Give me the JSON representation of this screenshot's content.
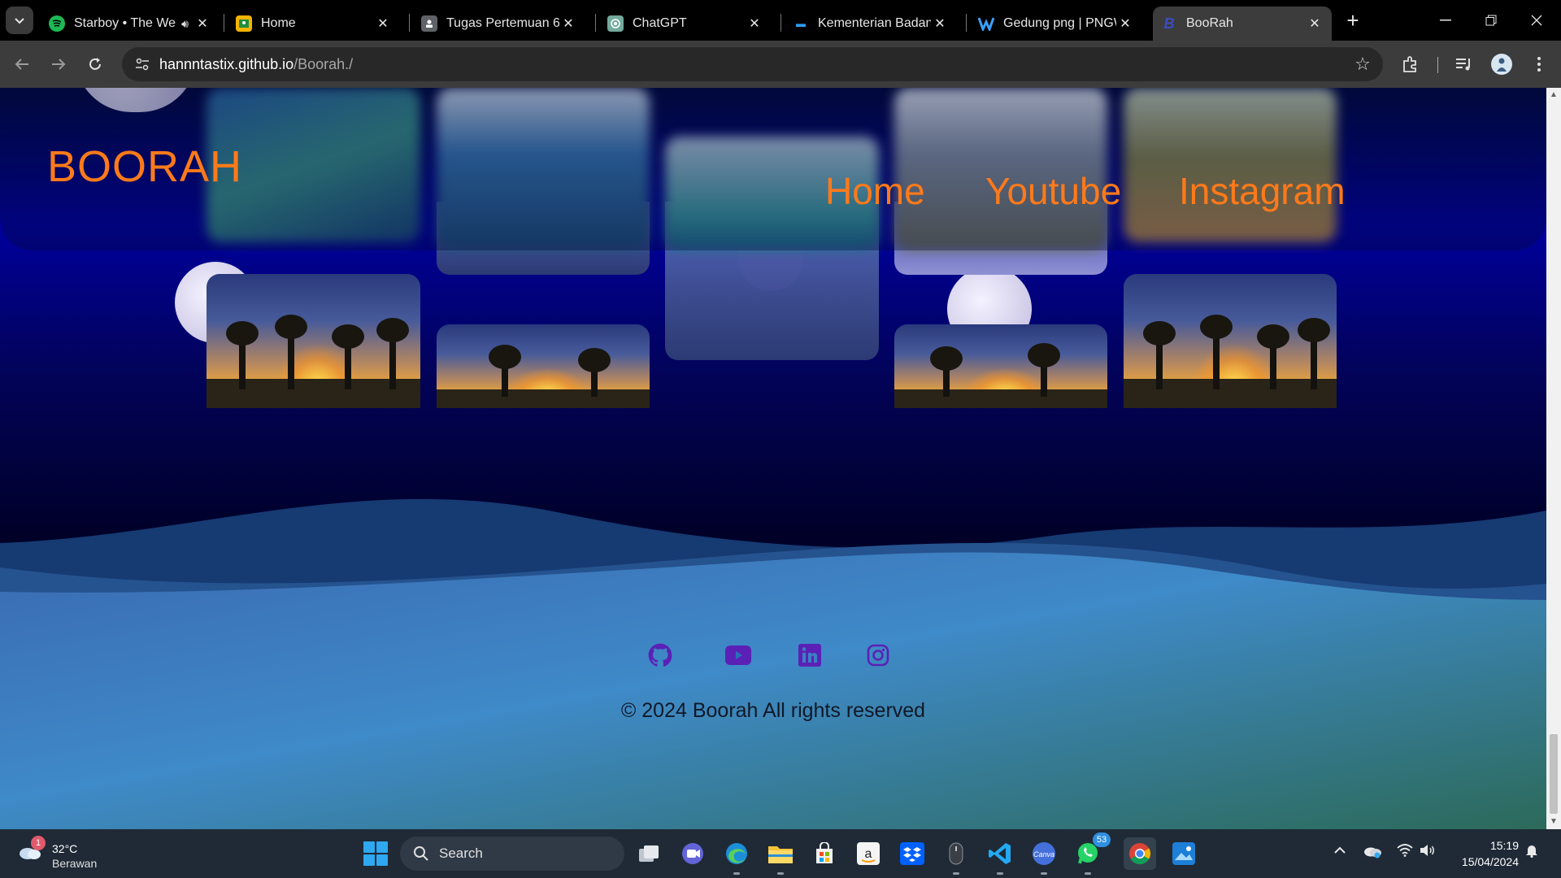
{
  "browser": {
    "tabs": [
      {
        "label": "Starboy • The We",
        "favicon": "spotify-icon",
        "audio": true,
        "active": false
      },
      {
        "label": "Home",
        "favicon": "classroom-icon",
        "audio": false,
        "active": false
      },
      {
        "label": "Tugas Pertemuan 6",
        "favicon": "assignment-icon",
        "audio": false,
        "active": false
      },
      {
        "label": "ChatGPT",
        "favicon": "chatgpt-icon",
        "audio": false,
        "active": false
      },
      {
        "label": "Kementerian Badan U",
        "favicon": "ministry-icon",
        "audio": false,
        "active": false
      },
      {
        "label": "Gedung png | PNGW",
        "favicon": "pngwing-icon",
        "audio": false,
        "active": false
      },
      {
        "label": "BooRah",
        "favicon": "boorah-icon",
        "audio": false,
        "active": true
      }
    ],
    "url_host": "hannntastix.github.io",
    "url_path": "/Boorah./"
  },
  "page": {
    "logo": "BOORAH",
    "nav": [
      "Home",
      "Youtube",
      "Instagram"
    ],
    "social_icons": [
      "github-icon",
      "youtube-icon",
      "linkedin-icon",
      "instagram-icon"
    ],
    "copyright": "© 2024 Boorah All rights reserved",
    "colors": {
      "accent": "#ff7a1a",
      "social": "#5b21b6"
    }
  },
  "taskbar": {
    "weather": {
      "badge": "1",
      "temp": "32°C",
      "condition": "Berawan"
    },
    "search_placeholder": "Search",
    "whatsapp_badge": "53",
    "time": "15:19",
    "date": "15/04/2024"
  }
}
